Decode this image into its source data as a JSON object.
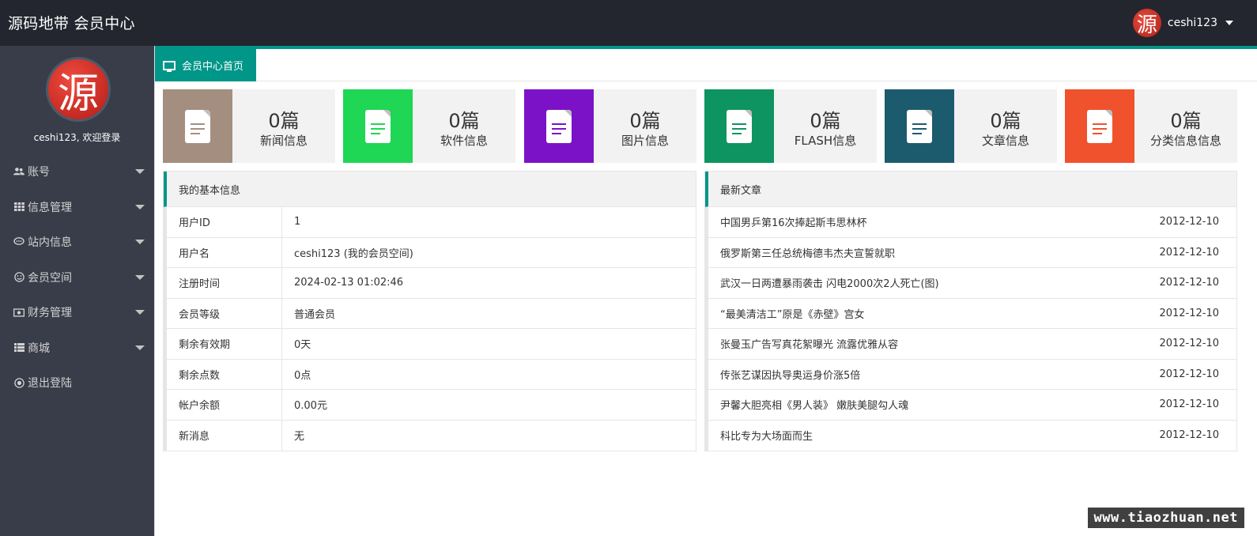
{
  "header": {
    "brand": "源码地带 会员中心",
    "avatar_glyph": "源",
    "username": "ceshi123"
  },
  "sidebar": {
    "avatar_glyph": "源",
    "welcome": "ceshi123, 欢迎登录",
    "items": [
      {
        "label": "账号",
        "icon": "users-icon",
        "expandable": true
      },
      {
        "label": "信息管理",
        "icon": "grid-icon",
        "expandable": true
      },
      {
        "label": "站内信息",
        "icon": "chat-icon",
        "expandable": true
      },
      {
        "label": "会员空间",
        "icon": "smile-icon",
        "expandable": true
      },
      {
        "label": "财务管理",
        "icon": "money-icon",
        "expandable": true
      },
      {
        "label": "商城",
        "icon": "list-icon",
        "expandable": true
      },
      {
        "label": "退出登陆",
        "icon": "radio-icon",
        "expandable": false
      }
    ]
  },
  "tabs": [
    {
      "label": "会员中心首页",
      "icon": "monitor-icon",
      "active": true
    }
  ],
  "stats": [
    {
      "value": "0篇",
      "label": "新闻信息",
      "color": "#a48e80"
    },
    {
      "value": "0篇",
      "label": "软件信息",
      "color": "#1fd655"
    },
    {
      "value": "0篇",
      "label": "图片信息",
      "color": "#7c12c8"
    },
    {
      "value": "0篇",
      "label": "FLASH信息",
      "color": "#0e9460"
    },
    {
      "value": "0篇",
      "label": "文章信息",
      "color": "#1c5b6e"
    },
    {
      "value": "0篇",
      "label": "分类信息信息",
      "color": "#f0522d"
    }
  ],
  "basic_info": {
    "title": "我的基本信息",
    "rows": [
      {
        "key": "用户ID",
        "value": "1"
      },
      {
        "key": "用户名",
        "value": "ceshi123 (我的会员空间)"
      },
      {
        "key": "注册时间",
        "value": "2024-02-13 01:02:46"
      },
      {
        "key": "会员等级",
        "value": "普通会员"
      },
      {
        "key": "剩余有效期",
        "value": "0天"
      },
      {
        "key": "剩余点数",
        "value": "0点"
      },
      {
        "key": "帐户余额",
        "value": "0.00元"
      },
      {
        "key": "新消息",
        "value": "无"
      }
    ]
  },
  "latest_articles": {
    "title": "最新文章",
    "rows": [
      {
        "title": "中国男乒第16次捧起斯韦思林杯",
        "date": "2012-12-10"
      },
      {
        "title": "俄罗斯第三任总统梅德韦杰夫宣誓就职",
        "date": "2012-12-10"
      },
      {
        "title": "武汉一日两遭暴雨袭击 闪电2000次2人死亡(图)",
        "date": "2012-12-10"
      },
      {
        "title": "“最美清洁工”原是《赤壁》宫女",
        "date": "2012-12-10"
      },
      {
        "title": "张曼玉广告写真花絮曝光 流露优雅从容",
        "date": "2012-12-10"
      },
      {
        "title": "传张艺谋因执导奥运身价涨5倍",
        "date": "2012-12-10"
      },
      {
        "title": "尹馨大胆亮相《男人装》 嫩肤美腿勾人魂",
        "date": "2012-12-10"
      },
      {
        "title": "科比专为大场面而生",
        "date": "2012-12-10"
      }
    ]
  },
  "watermark": "www.tiaozhuan.net",
  "colors": {
    "header_bg": "#23262e",
    "sidebar_bg": "#393d49",
    "accent": "#009688"
  }
}
